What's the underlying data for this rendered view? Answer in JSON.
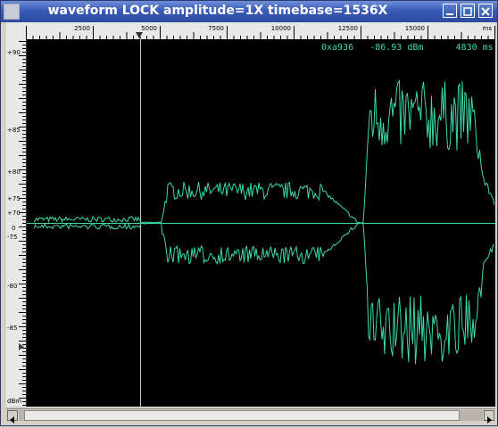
{
  "window": {
    "title": "waveform  LOCK amplitude=1X timebase=1536X"
  },
  "ruler_x": {
    "ticks": [
      "2500",
      "5000",
      "7500",
      "10000",
      "12500",
      "15000"
    ],
    "unit": "ms"
  },
  "ruler_y": {
    "upper_ticks": [
      "+90",
      "+85",
      "+80",
      "+75",
      "+70"
    ],
    "center": "0",
    "lower_ticks": [
      "-75",
      "-80",
      "-85"
    ],
    "unit": "dBm"
  },
  "readout": {
    "address": "0xa936",
    "level": "-86.93 dBm",
    "time": "4830 ms"
  },
  "colors": {
    "trace": "#3cd8a8",
    "background": "#000000",
    "cursor": "#c0c0c0"
  },
  "icons": {
    "window_icon": "app-icon",
    "minimize": "minimize-icon",
    "maximize": "maximize-icon",
    "close": "close-icon",
    "marker": "triangle-marker-icon"
  }
}
